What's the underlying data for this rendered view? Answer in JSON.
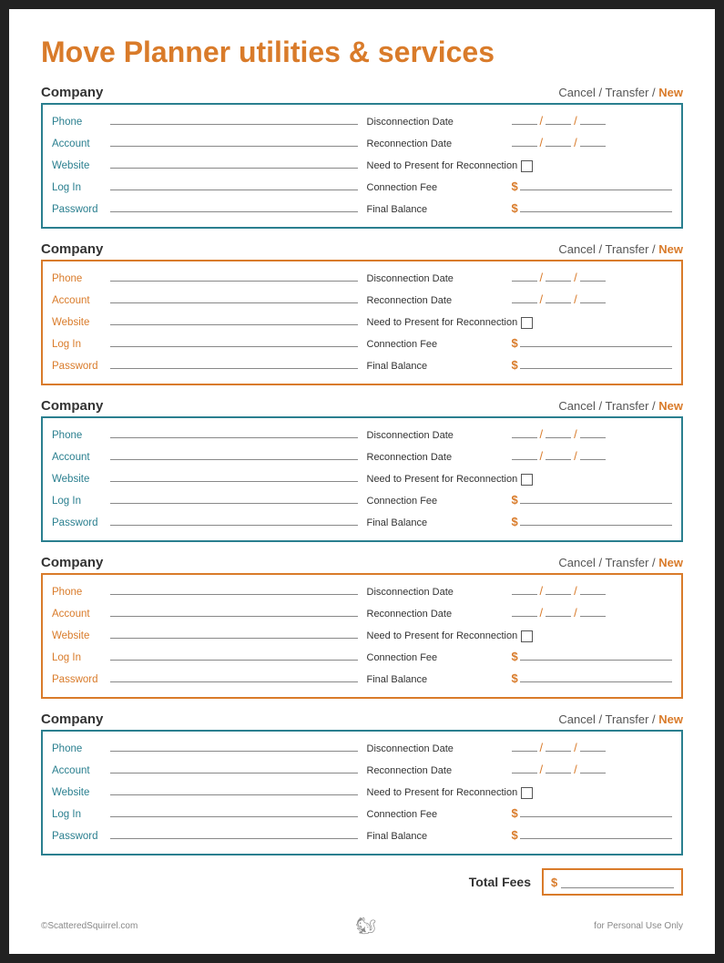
{
  "title": {
    "part1": "Move Planner ",
    "part2": "utilities & services"
  },
  "sections": [
    {
      "border": "teal",
      "fields_left_color": "teal"
    },
    {
      "border": "orange",
      "fields_left_color": "orange"
    },
    {
      "border": "teal",
      "fields_left_color": "teal"
    },
    {
      "border": "orange",
      "fields_left_color": "orange"
    },
    {
      "border": "teal",
      "fields_left_color": "teal"
    }
  ],
  "labels": {
    "company": "Company",
    "cancel_transfer_new": [
      "Cancel",
      " / ",
      "Transfer",
      " / ",
      "New"
    ],
    "phone": "Phone",
    "account": "Account",
    "website": "Website",
    "log_in": "Log In",
    "password": "Password",
    "disconnection_date": "Disconnection Date",
    "reconnection_date": "Reconnection Date",
    "need_to_present": "Need to Present for Reconnection",
    "connection_fee": "Connection Fee",
    "final_balance": "Final Balance",
    "total_fees": "Total Fees",
    "footer_left": "©ScatteredSquirrel.com",
    "footer_right": "for Personal Use Only"
  }
}
